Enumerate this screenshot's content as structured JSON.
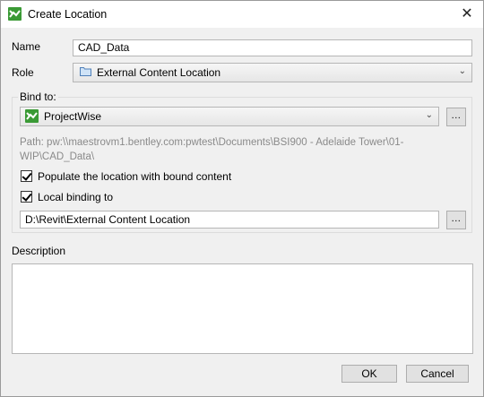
{
  "window": {
    "title": "Create Location",
    "close_symbol": "✕"
  },
  "form": {
    "name_label": "Name",
    "name_value": "CAD_Data",
    "role_label": "Role",
    "role_value": "External Content Location",
    "bind_label": "Bind to:",
    "bind_value": "ProjectWise",
    "path_text": "Path: pw:\\\\maestrovm1.bentley.com:pwtest\\Documents\\BSI900 - Adelaide Tower\\01-WIP\\CAD_Data\\",
    "populate_label": "Populate the location with bound content",
    "populate_checked": true,
    "local_binding_label": "Local binding to",
    "local_binding_checked": true,
    "local_path_value": "D:\\Revit\\External Content Location",
    "browse_label": "...",
    "description_label": "Description",
    "description_value": ""
  },
  "buttons": {
    "ok": "OK",
    "cancel": "Cancel"
  },
  "icons": {
    "app": "projectwise-icon",
    "role": "folder-icon",
    "bind": "projectwise-icon",
    "dropdown": "chevron-down-icon"
  },
  "colors": {
    "brand_green": "#3a9a35",
    "path_text": "#8a8a8a"
  }
}
